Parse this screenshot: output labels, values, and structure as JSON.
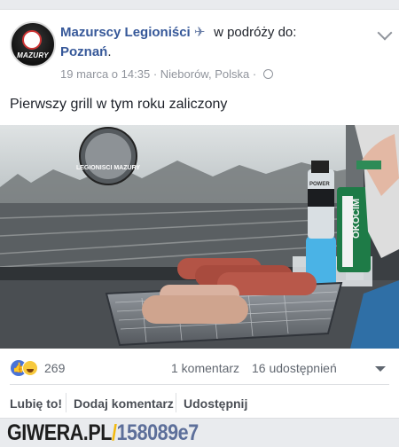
{
  "post": {
    "page_name": "Mazurscy Legioniści",
    "action": "w podróży do:",
    "place": "Poznań",
    "place_suffix": ".",
    "date": "19 marca o 14:35",
    "dot": "·",
    "location": "Nieborów, Polska",
    "meta_dot": "·",
    "text": "Pierwszy grill w tym roku zaliczony",
    "avatar_text": "MAZURY"
  },
  "photo": {
    "sticker_text": "LEGIONISCI MAZURY",
    "can_text": "OKOCIM",
    "bottle_label": "POWER"
  },
  "stats": {
    "reactions_count": "269",
    "comments": "1 komentarz",
    "shares": "16 udostępnień"
  },
  "actions": {
    "like": "Lubię to!",
    "comment": "Dodaj komentarz",
    "share": "Udostępnij"
  },
  "footer": {
    "site": "GIWERA.PL",
    "slash": "/",
    "hash": "158089e7"
  },
  "icons": {
    "plane": "airplane-icon",
    "globe": "globe-icon",
    "like": "thumbs-up-icon",
    "haha": "haha-emoji-icon"
  }
}
